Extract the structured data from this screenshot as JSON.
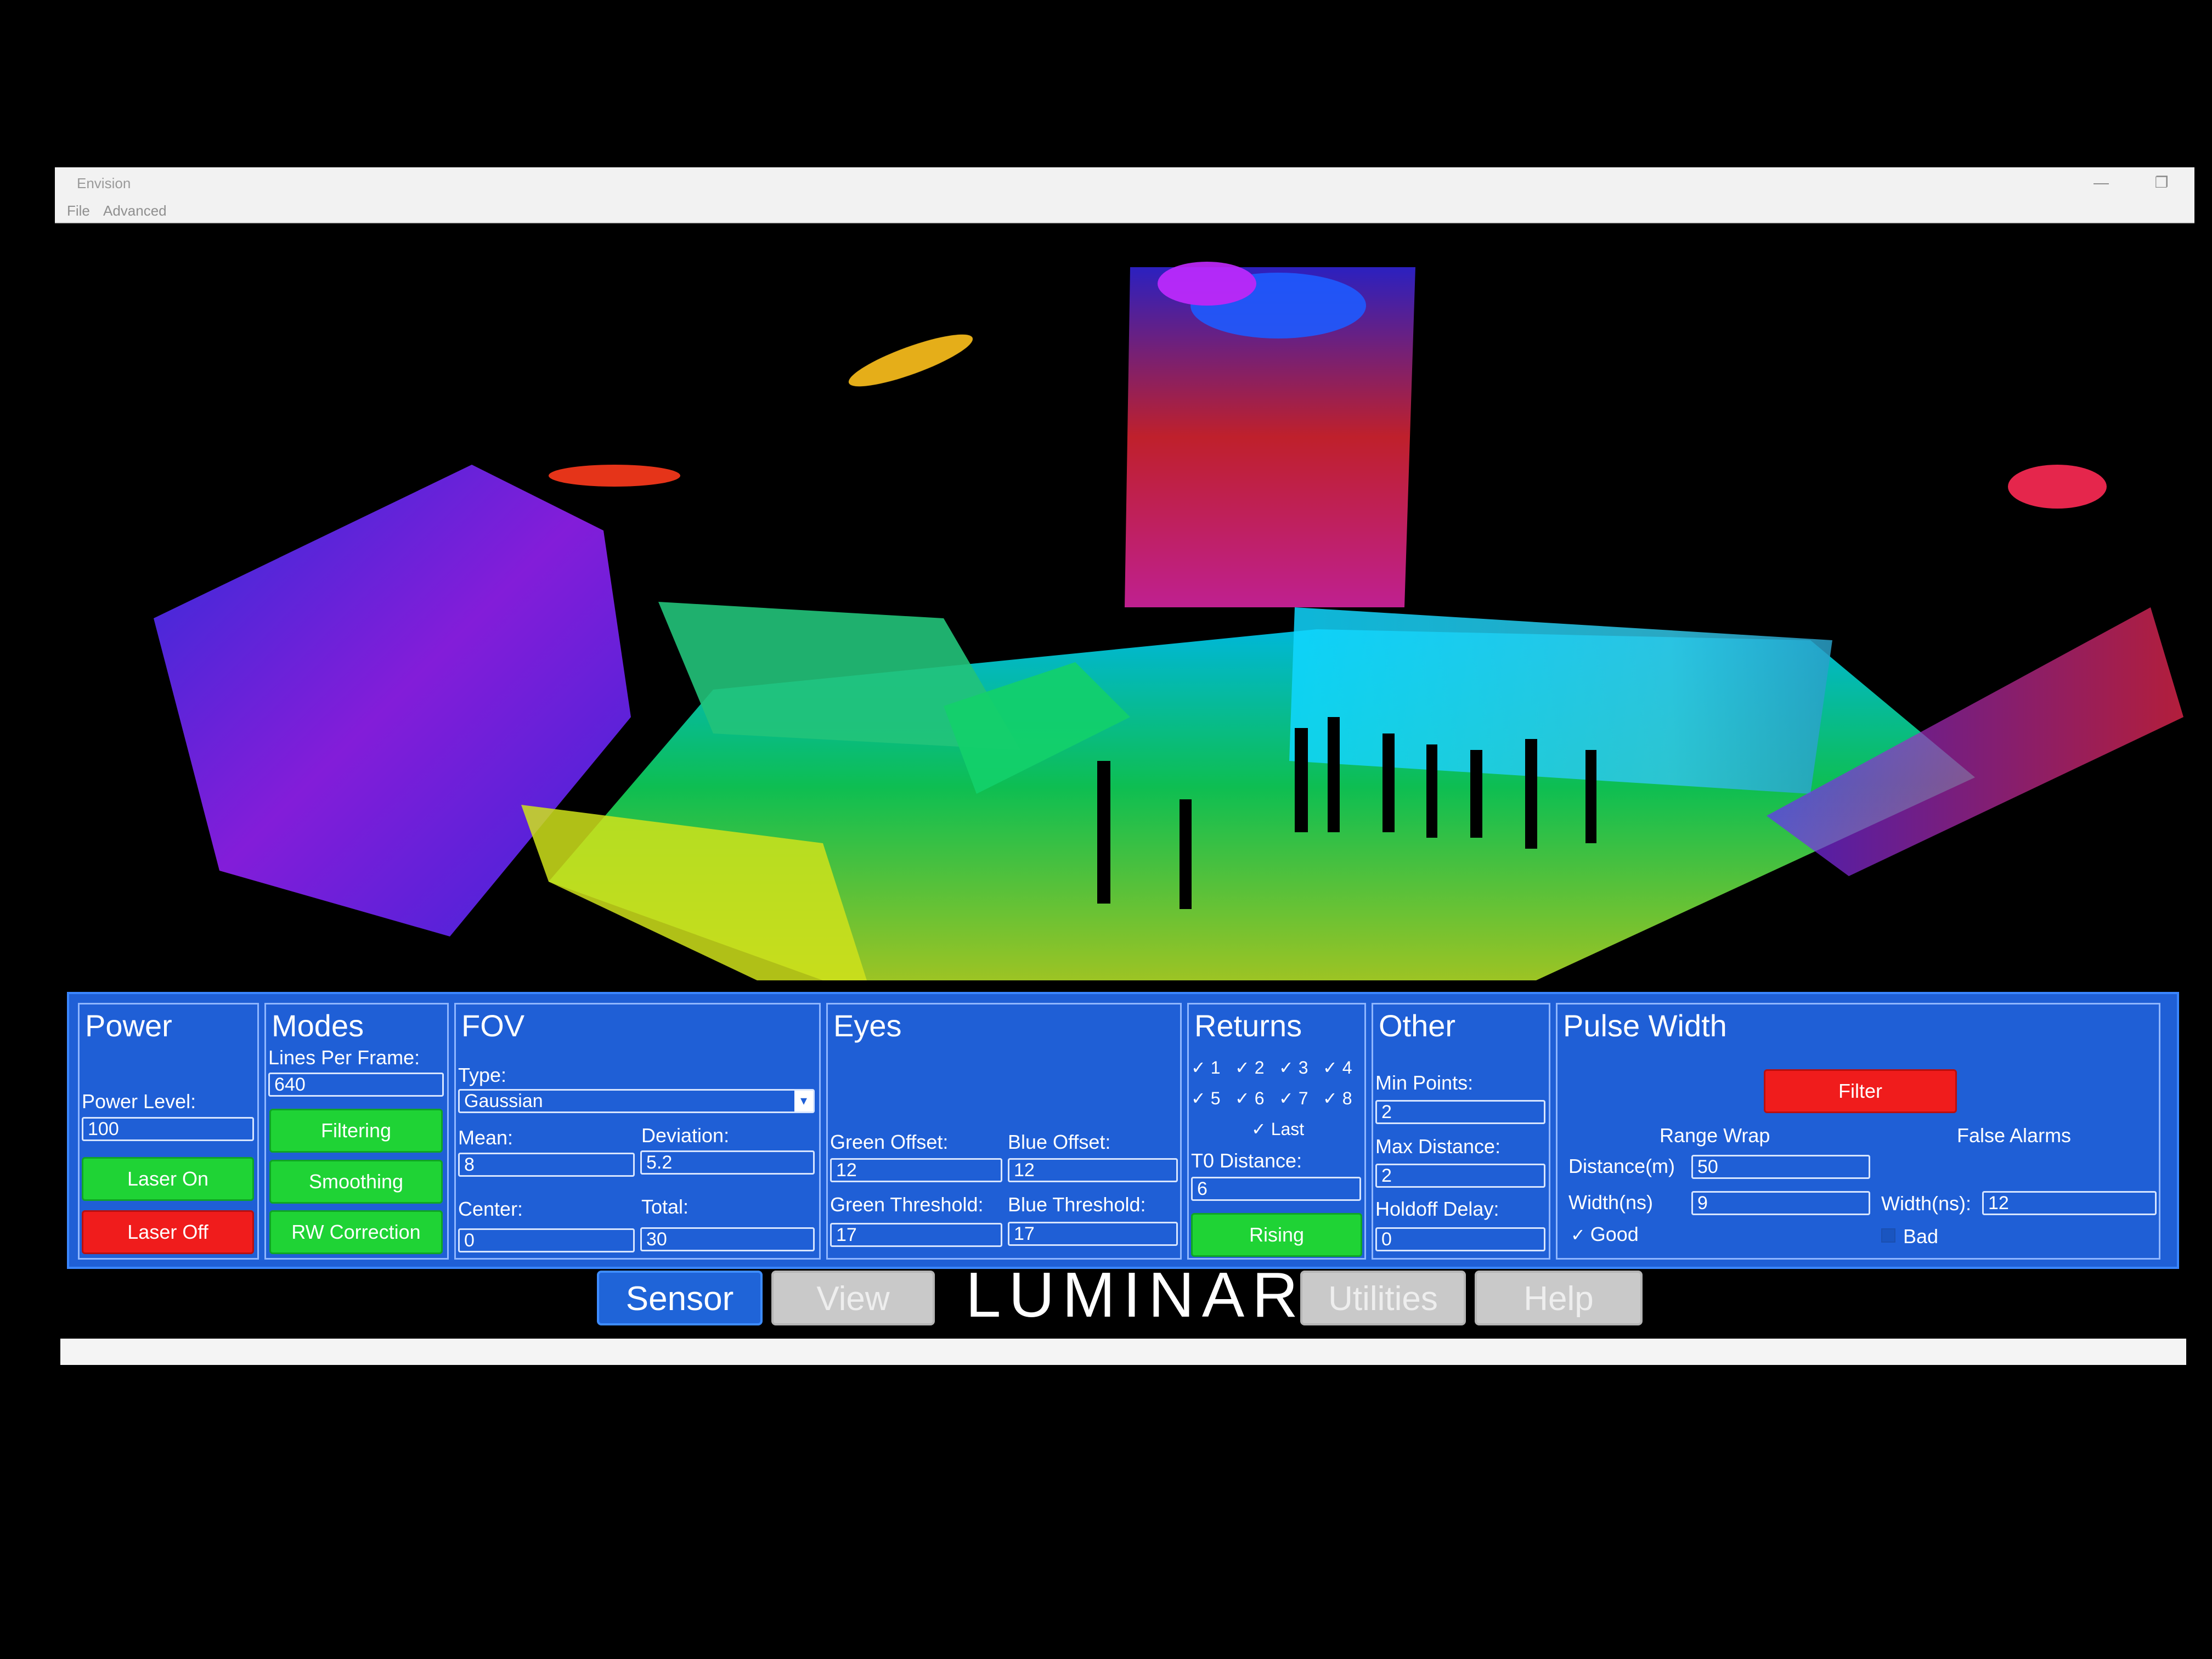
{
  "window": {
    "title": "Envision",
    "menu": [
      "File",
      "Advanced"
    ],
    "controls": {
      "minimize": "—",
      "restore": "❐",
      "close": "✕"
    }
  },
  "panel": {
    "power": {
      "title": "Power",
      "power_level_label": "Power Level:",
      "power_level_value": "100",
      "laser_on": "Laser On",
      "laser_off": "Laser Off"
    },
    "modes": {
      "title": "Modes",
      "lines_per_frame_label": "Lines Per Frame:",
      "lines_per_frame_value": "640",
      "filtering": "Filtering",
      "smoothing": "Smoothing",
      "rw_correction": "RW Correction"
    },
    "fov": {
      "title": "FOV",
      "type_label": "Type:",
      "type_value": "Gaussian",
      "mean_label": "Mean:",
      "mean_value": "8",
      "deviation_label": "Deviation:",
      "deviation_value": "5.2",
      "center_label": "Center:",
      "center_value": "0",
      "total_label": "Total:",
      "total_value": "30"
    },
    "eyes": {
      "title": "Eyes",
      "green_offset_label": "Green Offset:",
      "green_offset_value": "12",
      "blue_offset_label": "Blue Offset:",
      "blue_offset_value": "12",
      "green_threshold_label": "Green Threshold:",
      "green_threshold_value": "17",
      "blue_threshold_label": "Blue Threshold:",
      "blue_threshold_value": "17"
    },
    "returns": {
      "title": "Returns",
      "checks": [
        "1",
        "2",
        "3",
        "4",
        "5",
        "6",
        "7",
        "8"
      ],
      "last": "Last",
      "t0_label": "T0 Distance:",
      "t0_value": "6",
      "rising": "Rising",
      "check_mark": "✓"
    },
    "other": {
      "title": "Other",
      "min_points_label": "Min Points:",
      "min_points_value": "2",
      "max_distance_label": "Max Distance:",
      "max_distance_value": "2",
      "holdoff_label": "Holdoff Delay:",
      "holdoff_value": "0"
    },
    "pulse": {
      "title": "Pulse Width",
      "filter": "Filter",
      "range_wrap": "Range Wrap",
      "false_alarms": "False Alarms",
      "distance_label": "Distance(m)",
      "distance_value": "50",
      "width_label": "Width(ns)",
      "width_value": "9",
      "fa_width_label": "Width(ns):",
      "fa_width_value": "12",
      "good": "Good",
      "bad": "Bad"
    }
  },
  "nav": {
    "sensor": "Sensor",
    "view": "View",
    "logo": "LUMINAR",
    "utilities": "Utilities",
    "help": "Help"
  },
  "colors": {
    "panel_blue": "#1f5fd6",
    "green_button": "#1fd335",
    "red_button": "#f01c1c",
    "logo_accent_1": "#1fe04a",
    "logo_accent_2": "#2f6bff"
  }
}
